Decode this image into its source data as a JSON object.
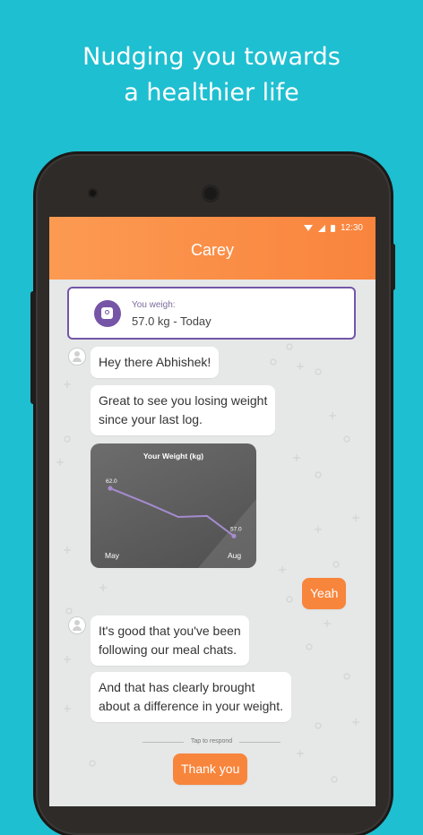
{
  "headline": {
    "line1": "Nudging you towards",
    "line2": "a healthier life"
  },
  "status_bar": {
    "time": "12:30"
  },
  "app_bar": {
    "title": "Carey"
  },
  "weight_card": {
    "label": "You weigh:",
    "value": "57.0 kg - Today"
  },
  "messages": [
    {
      "from": "bot",
      "text": "Hey there Abhishek!"
    },
    {
      "from": "bot",
      "lines": [
        "Great to see you losing weight",
        "since your  last log."
      ]
    },
    {
      "from": "user",
      "text": "Yeah"
    },
    {
      "from": "bot",
      "lines": [
        "It's good that you've been",
        "following our meal chats."
      ]
    },
    {
      "from": "bot",
      "lines": [
        "And that has clearly brought",
        "about a difference in your weight."
      ]
    }
  ],
  "chart_data": {
    "type": "line",
    "title": "Your Weight (kg)",
    "categories": [
      "May",
      "",
      "",
      "",
      "Aug"
    ],
    "values": [
      62.0,
      60.4,
      59.0,
      59.1,
      57.0
    ],
    "data_labels": [
      "62.0",
      "57.0"
    ],
    "x_tick_labels": [
      "May",
      "Aug"
    ],
    "line_color": "#a58bd0"
  },
  "respond": {
    "hint": "Tap to respond",
    "button": "Thank you"
  },
  "colors": {
    "background": "#1ebfd1",
    "app_bar": "#f98b44",
    "accent": "#7356a8",
    "user_bubble": "#f8853c"
  }
}
